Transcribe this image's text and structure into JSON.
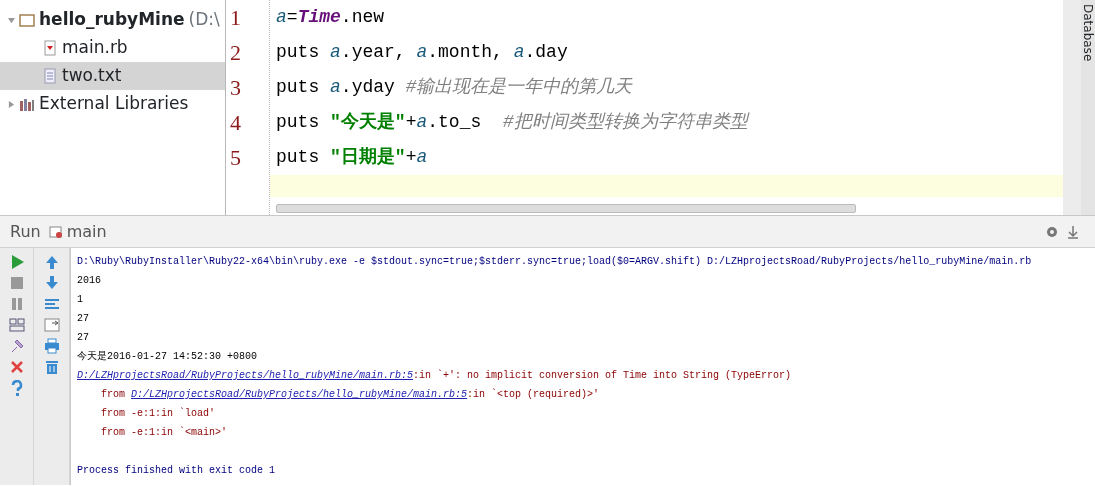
{
  "project_tree": {
    "root": {
      "label": "hello_rubyMine",
      "path": "(D:\\",
      "expanded": true,
      "children": [
        {
          "label": "main.rb",
          "kind": "ruby",
          "selected": false
        },
        {
          "label": "two.txt",
          "kind": "text",
          "selected": true
        }
      ]
    },
    "libraries": {
      "label": "External Libraries",
      "expanded": false
    }
  },
  "editor": {
    "lines": [
      {
        "number": "1",
        "tokens": [
          {
            "text": "a",
            "kind": "var"
          },
          {
            "text": "=",
            "kind": "plain"
          },
          {
            "text": "Time",
            "kind": "const"
          },
          {
            "text": ".new",
            "kind": "plain"
          }
        ]
      },
      {
        "number": "2",
        "tokens": [
          {
            "text": "puts ",
            "kind": "plain"
          },
          {
            "text": "a",
            "kind": "var"
          },
          {
            "text": ".year, ",
            "kind": "plain"
          },
          {
            "text": "a",
            "kind": "var"
          },
          {
            "text": ".month, ",
            "kind": "plain"
          },
          {
            "text": "a",
            "kind": "var"
          },
          {
            "text": ".day",
            "kind": "plain"
          }
        ]
      },
      {
        "number": "3",
        "tokens": [
          {
            "text": "puts ",
            "kind": "plain"
          },
          {
            "text": "a",
            "kind": "var"
          },
          {
            "text": ".yday ",
            "kind": "plain"
          },
          {
            "text": "#输出现在是一年中的第几天",
            "kind": "comment"
          }
        ]
      },
      {
        "number": "4",
        "tokens": [
          {
            "text": "puts ",
            "kind": "plain"
          },
          {
            "text": "\"今天是\"",
            "kind": "string"
          },
          {
            "text": "+",
            "kind": "plain"
          },
          {
            "text": "a",
            "kind": "var"
          },
          {
            "text": ".to_s  ",
            "kind": "plain"
          },
          {
            "text": "#把时间类型转换为字符串类型",
            "kind": "comment"
          }
        ]
      },
      {
        "number": "5",
        "tokens": [
          {
            "text": "puts ",
            "kind": "plain"
          },
          {
            "text": "\"日期是\"",
            "kind": "string"
          },
          {
            "text": "+",
            "kind": "plain"
          },
          {
            "text": "a",
            "kind": "var"
          }
        ]
      }
    ],
    "current_line": true
  },
  "side_tab": "Database",
  "run_panel": {
    "title": "Run",
    "config": "main",
    "console": [
      {
        "kind": "command",
        "parts": [
          {
            "text": "D:\\Ruby\\RubyInstaller\\Ruby22-x64\\bin\\ruby.exe -e $stdout.sync=true;$stderr.sync=true;load($0=ARGV.shift) D:/LZHprojectsRoad/RubyProjects/hello_rubyMine/main.rb",
            "kind": "plain"
          }
        ]
      },
      {
        "kind": "output",
        "parts": [
          {
            "text": "2016",
            "kind": "plain"
          }
        ]
      },
      {
        "kind": "output",
        "parts": [
          {
            "text": "1",
            "kind": "plain"
          }
        ]
      },
      {
        "kind": "output",
        "parts": [
          {
            "text": "27",
            "kind": "plain"
          }
        ]
      },
      {
        "kind": "output",
        "parts": [
          {
            "text": "27",
            "kind": "plain"
          }
        ]
      },
      {
        "kind": "output",
        "parts": [
          {
            "text": "今天是2016-01-27 14:52:30 +0800",
            "kind": "plain"
          }
        ]
      },
      {
        "kind": "error",
        "parts": [
          {
            "text": "D:/LZHprojectsRoad/RubyProjects/hello_rubyMine/main.rb:5",
            "kind": "link"
          },
          {
            "text": ":in `+': no implicit conversion of Time into String (TypeError)",
            "kind": "plain"
          }
        ]
      },
      {
        "kind": "trace",
        "parts": [
          {
            "text": "from ",
            "kind": "plain"
          },
          {
            "text": "D:/LZHprojectsRoad/RubyProjects/hello_rubyMine/main.rb:5",
            "kind": "link"
          },
          {
            "text": ":in `<top (required)>'",
            "kind": "plain"
          }
        ]
      },
      {
        "kind": "trace",
        "parts": [
          {
            "text": "from -e:1:in `load'",
            "kind": "plain"
          }
        ]
      },
      {
        "kind": "trace",
        "parts": [
          {
            "text": "from -e:1:in `<main>'",
            "kind": "plain"
          }
        ]
      },
      {
        "kind": "blank"
      },
      {
        "kind": "command",
        "parts": [
          {
            "text": "Process finished with exit code 1",
            "kind": "plain"
          }
        ]
      }
    ]
  }
}
